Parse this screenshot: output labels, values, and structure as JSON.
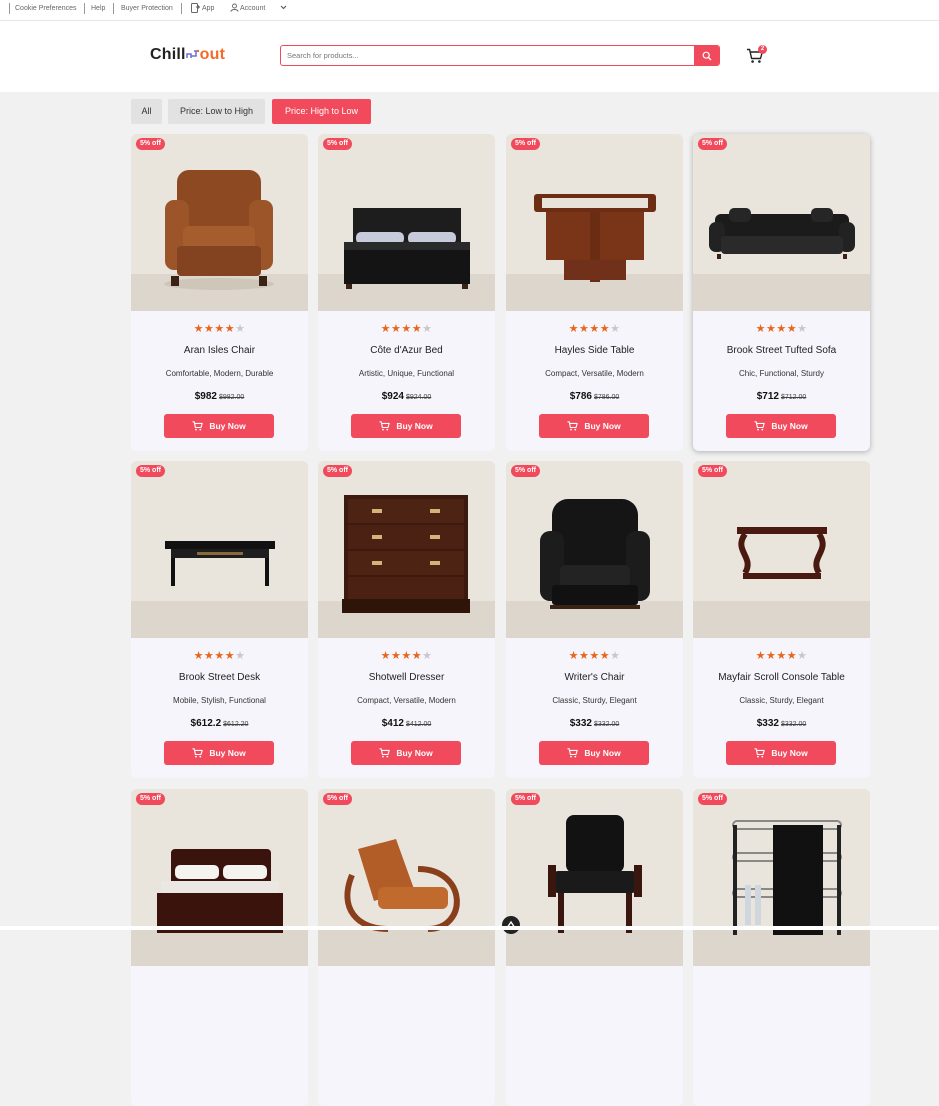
{
  "topbar": {
    "links": [
      "Cookie Preferences",
      "Help",
      "Buyer Protection",
      "App",
      "Account"
    ]
  },
  "header": {
    "logo_left": "Chill",
    "logo_right": "out",
    "search_placeholder": "Search for products...",
    "cart_count": "2"
  },
  "filters": [
    {
      "label": "All",
      "active": false
    },
    {
      "label": "Price: Low to High",
      "active": false
    },
    {
      "label": "Price: High to Low",
      "active": true
    }
  ],
  "buy_label": "Buy Now",
  "rating_stars": 4,
  "products": [
    {
      "badge": "5% off",
      "name": "Aran Isles Chair",
      "tags": "Comfortable, Modern, Durable",
      "price": "$982",
      "old_price": "$982.00",
      "image": "leather-armchair"
    },
    {
      "badge": "5% off",
      "name": "Côte d'Azur Bed",
      "tags": "Artistic, Unique, Functional",
      "price": "$924",
      "old_price": "$924.00",
      "image": "black-bed"
    },
    {
      "badge": "5% off",
      "name": "Hayles Side Table",
      "tags": "Compact, Versatile, Modern",
      "price": "$786",
      "old_price": "$786.00",
      "image": "wood-side-table"
    },
    {
      "badge": "5% off",
      "name": "Brook Street Tufted Sofa",
      "tags": "Chic, Functional, Sturdy",
      "price": "$712",
      "old_price": "$712.00",
      "image": "tufted-sofa"
    },
    {
      "badge": "5% off",
      "name": "Brook Street Desk",
      "tags": "Mobile, Stylish, Functional",
      "price": "$612.2",
      "old_price": "$612.20",
      "image": "black-desk"
    },
    {
      "badge": "5% off",
      "name": "Shotwell Dresser",
      "tags": "Compact, Versatile, Modern",
      "price": "$412",
      "old_price": "$412.00",
      "image": "wood-dresser"
    },
    {
      "badge": "5% off",
      "name": "Writer's Chair",
      "tags": "Classic, Sturdy, Elegant",
      "price": "$332",
      "old_price": "$332.00",
      "image": "black-wingback-chair"
    },
    {
      "badge": "5% off",
      "name": "Mayfair Scroll Console Table",
      "tags": "Classic, Sturdy, Elegant",
      "price": "$332",
      "old_price": "$332.00",
      "image": "console-table"
    },
    {
      "badge": "5% off",
      "image": "sleigh-bed"
    },
    {
      "badge": "5% off",
      "image": "tan-lounge-chair"
    },
    {
      "badge": "5% off",
      "image": "black-side-chair"
    },
    {
      "badge": "5% off",
      "image": "bar-cart"
    }
  ],
  "colors": {
    "accent": "#f04a5c",
    "star": "#e8651c",
    "logo_accent": "#f26b2a",
    "page_bg": "#f1f1f1",
    "card_bg": "#f7f5fc"
  }
}
